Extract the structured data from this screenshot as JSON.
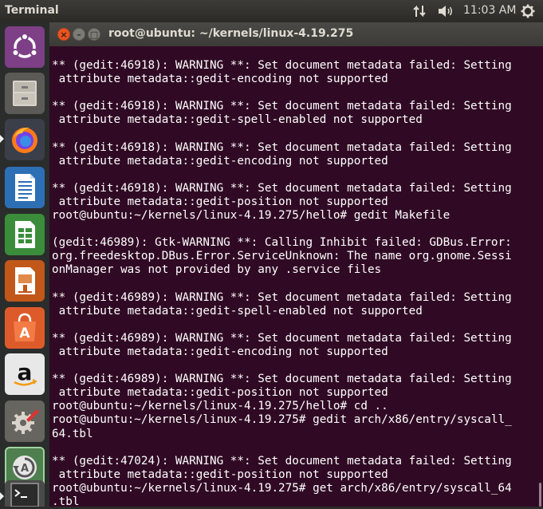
{
  "top_panel": {
    "app_title": "Terminal",
    "clock": "11:03 AM",
    "icons": [
      "network-icon",
      "volume-icon",
      "gear-icon"
    ]
  },
  "launcher": {
    "items": [
      {
        "name": "ubuntu-dash-icon"
      },
      {
        "name": "files-icon"
      },
      {
        "name": "firefox-icon"
      },
      {
        "name": "libreoffice-writer-icon"
      },
      {
        "name": "libreoffice-calc-icon"
      },
      {
        "name": "libreoffice-impress-icon"
      },
      {
        "name": "software-center-icon"
      },
      {
        "name": "amazon-icon"
      },
      {
        "name": "system-settings-icon"
      },
      {
        "name": "software-updater-icon"
      },
      {
        "name": "terminal-icon"
      }
    ]
  },
  "window": {
    "title": "root@ubuntu: ~/kernels/linux-4.19.275",
    "buttons": {
      "close": "×",
      "minimize": "–",
      "maximize": "□"
    }
  },
  "terminal": {
    "lines": [
      "** (gedit:46918): WARNING **: Set document metadata failed: Setting",
      " attribute metadata::gedit-encoding not supported",
      "",
      "** (gedit:46918): WARNING **: Set document metadata failed: Setting",
      " attribute metadata::gedit-spell-enabled not supported",
      "",
      "** (gedit:46918): WARNING **: Set document metadata failed: Setting",
      " attribute metadata::gedit-encoding not supported",
      "",
      "** (gedit:46918): WARNING **: Set document metadata failed: Setting",
      " attribute metadata::gedit-position not supported",
      "root@ubuntu:~/kernels/linux-4.19.275/hello# gedit Makefile",
      "",
      "(gedit:46989): Gtk-WARNING **: Calling Inhibit failed: GDBus.Error:",
      "org.freedesktop.DBus.Error.ServiceUnknown: The name org.gnome.Sessi",
      "onManager was not provided by any .service files",
      "",
      "** (gedit:46989): WARNING **: Set document metadata failed: Setting",
      " attribute metadata::gedit-spell-enabled not supported",
      "",
      "** (gedit:46989): WARNING **: Set document metadata failed: Setting",
      " attribute metadata::gedit-encoding not supported",
      "",
      "** (gedit:46989): WARNING **: Set document metadata failed: Setting",
      " attribute metadata::gedit-position not supported",
      "root@ubuntu:~/kernels/linux-4.19.275/hello# cd ..",
      "root@ubuntu:~/kernels/linux-4.19.275# gedit arch/x86/entry/syscall_",
      "64.tbl",
      "",
      "** (gedit:47024): WARNING **: Set document metadata failed: Setting",
      " attribute metadata::gedit-position not supported",
      "root@ubuntu:~/kernels/linux-4.19.275# get arch/x86/entry/syscall_64",
      ".tbl"
    ]
  }
}
